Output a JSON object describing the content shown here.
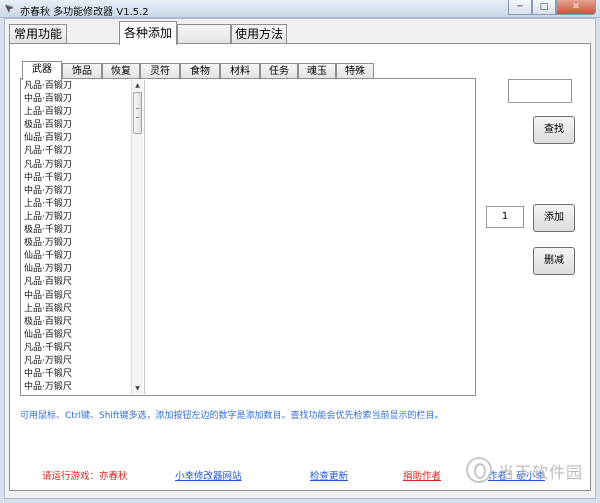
{
  "window": {
    "title": "亦春秋 多功能修改器  V1.5.2",
    "controls": {
      "minimize": "─",
      "maximize": "□",
      "close": "✕"
    }
  },
  "main_tabs": [
    "常用功能",
    "各种添加",
    "使用方法"
  ],
  "sub_tabs": [
    "武器",
    "饰品",
    "恢复",
    "灵符",
    "食物",
    "材料",
    "任务",
    "魂玉",
    "特殊"
  ],
  "item_list": [
    "凡品·百锻刀",
    "中品·百锻刀",
    "上品·百锻刀",
    "极品·百锻刀",
    "仙品·百锻刀",
    "凡品·千锻刀",
    "凡品·万锻刀",
    "中品·千锻刀",
    "中品·万锻刀",
    "上品·千锻刀",
    "上品·万锻刀",
    "极品·千锻刀",
    "极品·万锻刀",
    "仙品·千锻刀",
    "仙品·万锻刀",
    "凡品·百锻尺",
    "中品·百锻尺",
    "上品·百锻尺",
    "极品·百锻尺",
    "仙品·百锻尺",
    "凡品·千锻尺",
    "凡品·万锻尺",
    "中品·千锻尺",
    "中品·万锻尺"
  ],
  "search": {
    "value": "",
    "button": "查找"
  },
  "quantity": {
    "value": "1"
  },
  "add_button": "添加",
  "delete_button": "删减",
  "hint": "可用鼠标、Ctrl键、Shift键多选，添加按钮左边的数字是添加数目。查找功能会优先检索当前显示的栏目。",
  "footer": {
    "game_notice": "请运行游戏：亦春秋",
    "site_link": "小幸修改器网站",
    "update_link": "检查更新",
    "donate_link": "捐助作者",
    "author_link": "作者：硬小幸"
  },
  "watermark": "当下软件园",
  "colors": {
    "hint": "#2f6fd8",
    "red_text": "#d9261c",
    "link": "#1f54d6"
  }
}
